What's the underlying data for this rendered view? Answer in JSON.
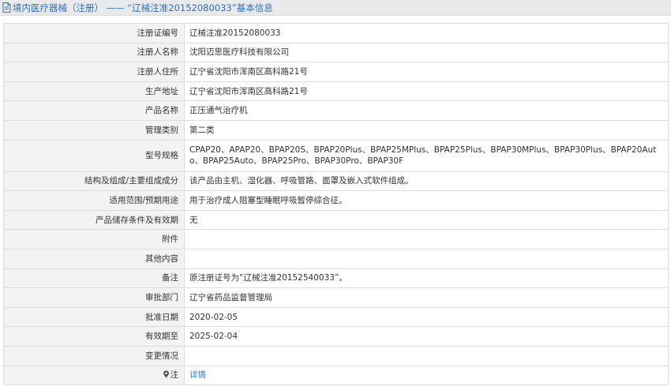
{
  "header": {
    "icon": "document-icon",
    "title": "境内医疗器械（注册） —— “辽械注准20152080033”基本信息"
  },
  "rows": [
    {
      "label": "注册证编号",
      "value": "辽械注准20152080033"
    },
    {
      "label": "注册人名称",
      "value": "沈阳迈思医疗科技有限公司"
    },
    {
      "label": "注册人住所",
      "value": "辽宁省沈阳市浑南区高科路21号"
    },
    {
      "label": "生产地址",
      "value": "辽宁省沈阳市浑南区高科路21号"
    },
    {
      "label": "产品名称",
      "value": "正压通气治疗机"
    },
    {
      "label": "管理类别",
      "value": "第二类"
    },
    {
      "label": "型号规格",
      "value": "CPAP20、APAP20、BPAP20S、BPAP20Plus、BPAP25MPlus、BPAP25Plus、BPAP30MPlus、BPAP30Plus、BPAP20Auto、BPAP25Auto、BPAP25Pro、BPAP30Pro、BPAP30F"
    },
    {
      "label": "结构及组成/主要组成成分",
      "value": "该产品由主机、湿化器、呼吸管路、面罩及嵌入式软件组成。"
    },
    {
      "label": "适用范围/预期用途",
      "value": "用于治疗成人阻塞型睡眠呼吸暂停综合征。"
    },
    {
      "label": "产品储存条件及有效期",
      "value": "无"
    },
    {
      "label": "附件",
      "value": ""
    },
    {
      "label": "其他内容",
      "value": ""
    },
    {
      "label": "备注",
      "value": "原注册证号为“辽械注准20152540033”。"
    },
    {
      "label": "审批部门",
      "value": "辽宁省药品监督管理局"
    },
    {
      "label": "批准日期",
      "value": "2020-02-05"
    },
    {
      "label": "有效期至",
      "value": "2025-02-04"
    },
    {
      "label": "变更情况",
      "value": ""
    },
    {
      "label": "注",
      "label_icon": "pin-icon",
      "value": "详情"
    }
  ],
  "colors": {
    "link": "#2f7fd2",
    "header_text": "#2f6fb8",
    "label_bg": "#f3f3f3",
    "border": "#dddddd"
  }
}
